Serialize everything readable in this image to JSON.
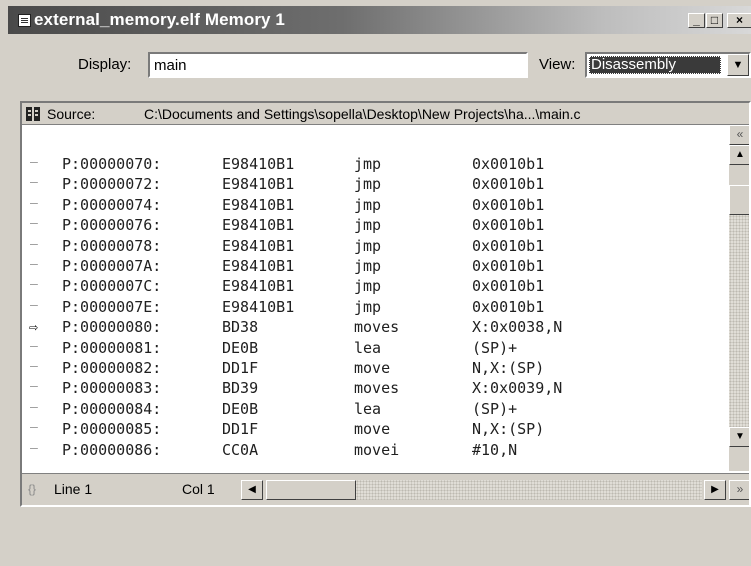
{
  "window": {
    "title": "external_memory.elf Memory 1",
    "minimize": "_",
    "maximize": "□",
    "close": "×"
  },
  "display": {
    "label": "Display:",
    "value": "main"
  },
  "view": {
    "label": "View:",
    "value": "Disassembly",
    "arrow": "▼"
  },
  "source": {
    "label": "Source:",
    "path": "C:\\Documents and Settings\\sopella\\Desktop\\New Projects\\ha...\\main.c"
  },
  "code_lines": [
    {
      "marker": "–",
      "address": "P:00000070:",
      "hex": "E98410B1",
      "mnemonic": "jmp",
      "operands": "0x0010b1",
      "current": false
    },
    {
      "marker": "–",
      "address": "P:00000072:",
      "hex": "E98410B1",
      "mnemonic": "jmp",
      "operands": "0x0010b1",
      "current": false
    },
    {
      "marker": "–",
      "address": "P:00000074:",
      "hex": "E98410B1",
      "mnemonic": "jmp",
      "operands": "0x0010b1",
      "current": false
    },
    {
      "marker": "–",
      "address": "P:00000076:",
      "hex": "E98410B1",
      "mnemonic": "jmp",
      "operands": "0x0010b1",
      "current": false
    },
    {
      "marker": "–",
      "address": "P:00000078:",
      "hex": "E98410B1",
      "mnemonic": "jmp",
      "operands": "0x0010b1",
      "current": false
    },
    {
      "marker": "–",
      "address": "P:0000007A:",
      "hex": "E98410B1",
      "mnemonic": "jmp",
      "operands": "0x0010b1",
      "current": false
    },
    {
      "marker": "–",
      "address": "P:0000007C:",
      "hex": "E98410B1",
      "mnemonic": "jmp",
      "operands": "0x0010b1",
      "current": false
    },
    {
      "marker": "–",
      "address": "P:0000007E:",
      "hex": "E98410B1",
      "mnemonic": "jmp",
      "operands": "0x0010b1",
      "current": false
    },
    {
      "marker": "⇨",
      "address": "P:00000080:",
      "hex": "BD38",
      "mnemonic": "moves",
      "operands": "X:0x0038,N",
      "current": true
    },
    {
      "marker": "–",
      "address": "P:00000081:",
      "hex": "DE0B",
      "mnemonic": "lea",
      "operands": "(SP)+",
      "current": false
    },
    {
      "marker": "–",
      "address": "P:00000082:",
      "hex": "DD1F",
      "mnemonic": "move",
      "operands": "N,X:(SP)",
      "current": false
    },
    {
      "marker": "–",
      "address": "P:00000083:",
      "hex": "BD39",
      "mnemonic": "moves",
      "operands": "X:0x0039,N",
      "current": false
    },
    {
      "marker": "–",
      "address": "P:00000084:",
      "hex": "DE0B",
      "mnemonic": "lea",
      "operands": "(SP)+",
      "current": false
    },
    {
      "marker": "–",
      "address": "P:00000085:",
      "hex": "DD1F",
      "mnemonic": "move",
      "operands": "N,X:(SP)",
      "current": false
    },
    {
      "marker": "–",
      "address": "P:00000086:",
      "hex": "CC0A",
      "mnemonic": "movei",
      "operands": "#10,N",
      "current": false
    }
  ],
  "status": {
    "braces": "{}",
    "line": "Line 1",
    "col": "Col 1"
  },
  "scroll": {
    "up_double": "«",
    "up": "▲",
    "down": "▼",
    "down_double": "»",
    "left": "◀",
    "right": "▶"
  }
}
